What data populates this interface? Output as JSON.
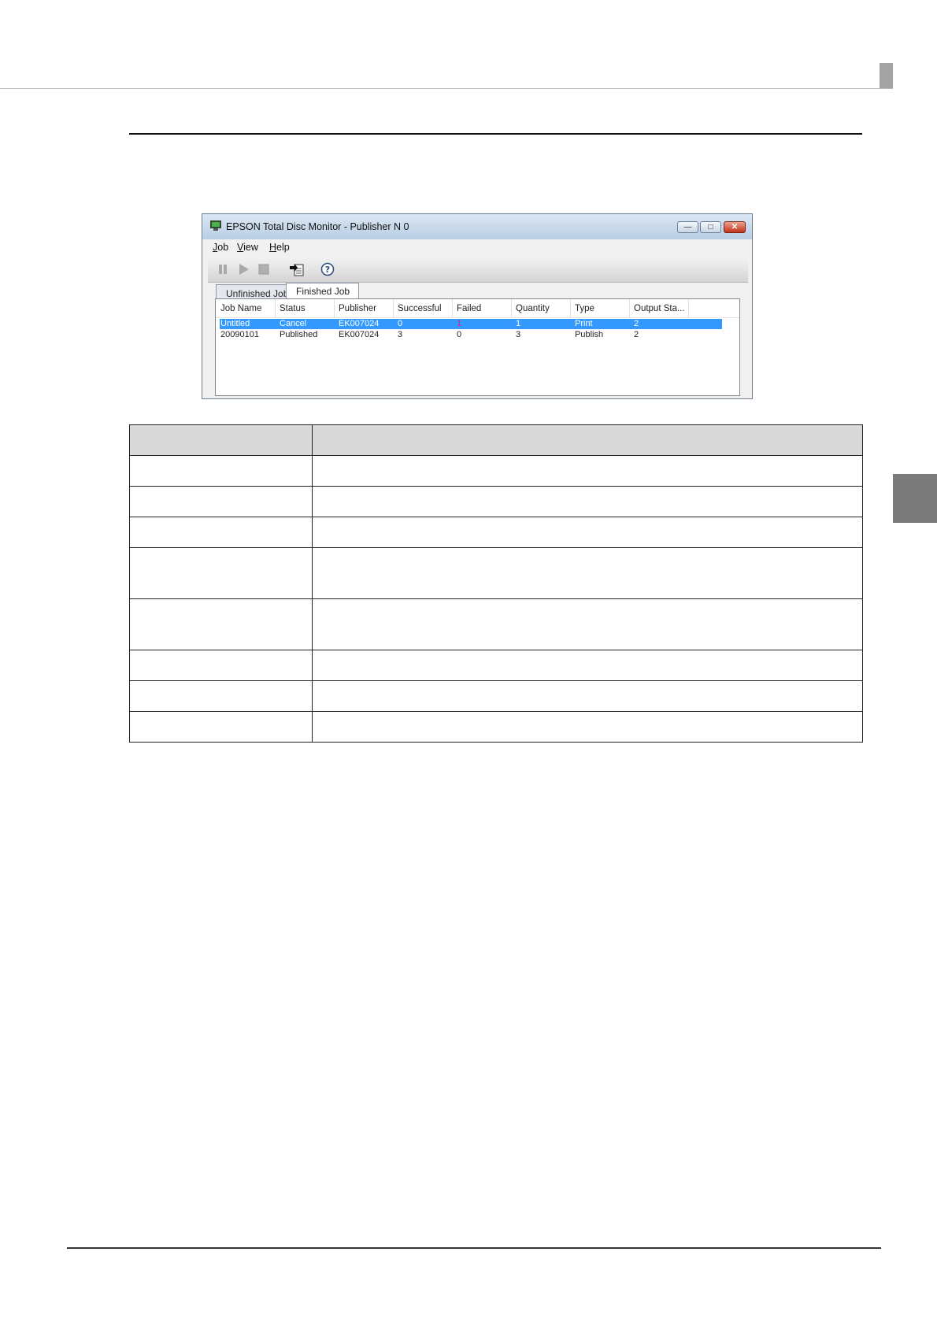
{
  "window": {
    "title": "EPSON Total Disc Monitor - Publisher N 0",
    "menu": [
      {
        "key": "J",
        "rest": "ob"
      },
      {
        "key": "V",
        "rest": "iew"
      },
      {
        "key": "H",
        "rest": "elp"
      }
    ],
    "toolbar_icons": [
      "pause-icon",
      "play-icon",
      "stop-icon",
      "export-job-icon",
      "help-icon"
    ],
    "tabs": [
      "Unfinished Job",
      "Finished Job"
    ],
    "active_tab": "Finished Job",
    "columns": [
      "Job Name",
      "Status",
      "Publisher",
      "Successful",
      "Failed",
      "Quantity",
      "Type",
      "Output Sta..."
    ],
    "rows": [
      {
        "job_name": "Untitled",
        "status": "Cancel",
        "publisher": "EK007024",
        "successful": "0",
        "failed": "1",
        "quantity": "1",
        "type": "Print",
        "output": "2",
        "selected": true
      },
      {
        "job_name": "20090101",
        "status": "Published",
        "publisher": "EK007024",
        "successful": "3",
        "failed": "0",
        "quantity": "3",
        "type": "Publish",
        "output": "2",
        "selected": false
      }
    ]
  },
  "colors": {
    "selection": "#3399ff",
    "table_header": "#d9d9d9",
    "side_tab": "#7b7b7b"
  }
}
